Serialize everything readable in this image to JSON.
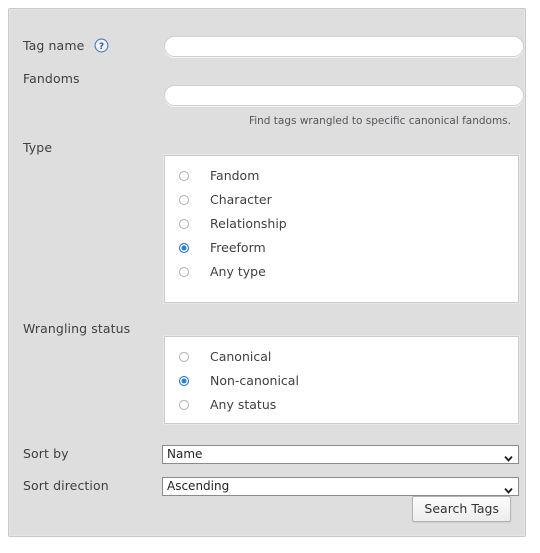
{
  "form": {
    "name": "tag-search-form",
    "fields": {
      "tag_name": {
        "label": "Tag name",
        "value": "",
        "placeholder": "",
        "help_icon": "question-mark-icon"
      },
      "fandoms": {
        "label": "Fandoms",
        "value": "",
        "placeholder": "",
        "hint": "Find tags wrangled to specific canonical fandoms."
      }
    },
    "type_group": {
      "legend": "Type",
      "options": [
        {
          "label": "Fandom",
          "checked": false
        },
        {
          "label": "Character",
          "checked": false
        },
        {
          "label": "Relationship",
          "checked": false
        },
        {
          "label": "Freeform",
          "checked": true
        },
        {
          "label": "Any type",
          "checked": false
        }
      ]
    },
    "status_group": {
      "legend": "Wrangling status",
      "options": [
        {
          "label": "Canonical",
          "checked": false
        },
        {
          "label": "Non-canonical",
          "checked": true
        },
        {
          "label": "Any status",
          "checked": false
        }
      ]
    },
    "sort_by": {
      "label": "Sort by",
      "value": "Name"
    },
    "sort_direction": {
      "label": "Sort direction",
      "value": "Ascending"
    },
    "submit": {
      "label": "Search Tags"
    }
  },
  "colors": {
    "panel_bg": "#dedede",
    "panel_border": "#c9c9c9",
    "text": "#3f3f3f",
    "accent_radio": "#1c7ef0",
    "help_icon": "#4a7cb5",
    "field_bg": "#ffffff"
  }
}
